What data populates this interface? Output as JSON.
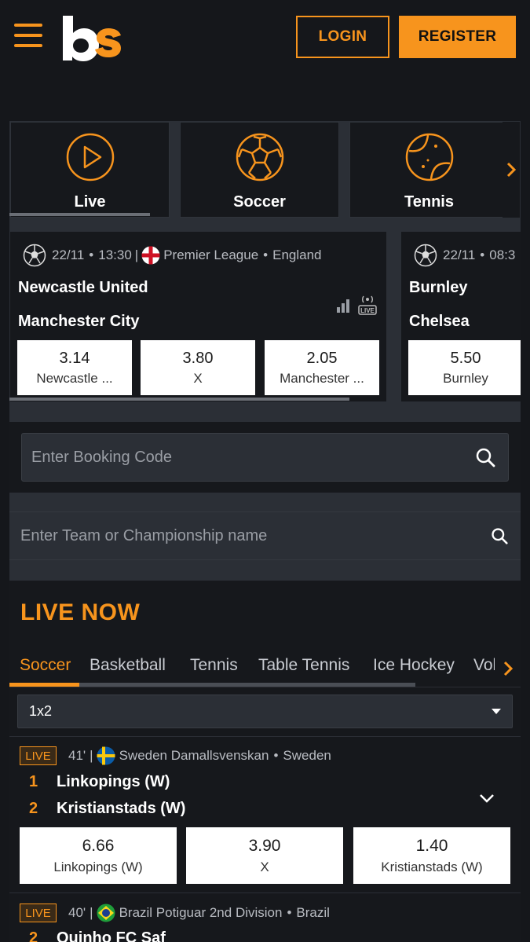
{
  "header": {
    "logo_text": "bs",
    "login_label": "LOGIN",
    "register_label": "REGISTER"
  },
  "sports": [
    {
      "label": "Live",
      "icon": "play-icon"
    },
    {
      "label": "Soccer",
      "icon": "soccer-ball-icon"
    },
    {
      "label": "Tennis",
      "icon": "tennis-ball-icon"
    }
  ],
  "featured_matches": [
    {
      "date": "22/11",
      "time": "13:30",
      "league": "Premier League",
      "country": "England",
      "home": "Newcastle United",
      "away": "Manchester City",
      "odds": [
        {
          "value": "3.14",
          "label": "Newcastle ..."
        },
        {
          "value": "3.80",
          "label": "X"
        },
        {
          "value": "2.05",
          "label": "Manchester ..."
        }
      ]
    },
    {
      "date": "22/11",
      "time": "08:3",
      "home": "Burnley",
      "away": "Chelsea",
      "odds": [
        {
          "value": "5.50",
          "label": "Burnley"
        }
      ]
    }
  ],
  "booking": {
    "placeholder": "Enter Booking Code"
  },
  "team_search": {
    "placeholder": "Enter Team or Championship name"
  },
  "live_now": {
    "title": "LIVE NOW",
    "tabs": [
      "Soccer",
      "Basketball",
      "Tennis",
      "Table Tennis",
      "Ice Hockey",
      "Volley"
    ],
    "active_tab": "Soccer",
    "market": "1x2",
    "events": [
      {
        "badge": "LIVE",
        "minute": "41'",
        "competition": "Sweden Damallsvenskan",
        "country": "Sweden",
        "rank_home": "1",
        "home": "Linkopings (W)",
        "rank_away": "2",
        "away": "Kristianstads (W)",
        "odds": [
          {
            "value": "6.66",
            "label": "Linkopings (W)"
          },
          {
            "value": "3.90",
            "label": "X"
          },
          {
            "value": "1.40",
            "label": "Kristianstads (W)"
          }
        ]
      },
      {
        "badge": "LIVE",
        "minute": "40'",
        "competition": "Brazil Potiguar 2nd Division",
        "country": "Brazil",
        "rank_home": "2",
        "home": "Quinho FC Saf"
      }
    ]
  },
  "colors": {
    "accent": "#f7941d",
    "background": "#15171b",
    "panel": "#2b2f36"
  }
}
